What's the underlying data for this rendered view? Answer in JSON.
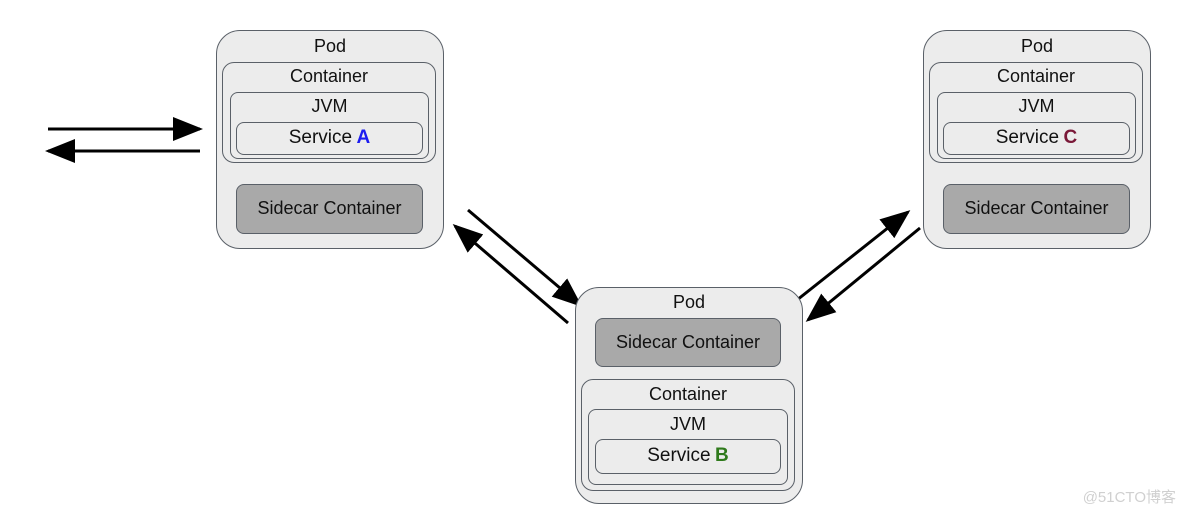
{
  "pods": [
    {
      "id": "a",
      "title": "Pod",
      "container": "Container",
      "jvm": "JVM",
      "service": "Service",
      "letter": "A",
      "letter_color": "#1c1cf0",
      "sidecar": "Sidecar Container"
    },
    {
      "id": "b",
      "title": "Pod",
      "container": "Container",
      "jvm": "JVM",
      "service": "Service",
      "letter": "B",
      "letter_color": "#2f7a1c",
      "sidecar": "Sidecar Container"
    },
    {
      "id": "c",
      "title": "Pod",
      "container": "Container",
      "jvm": "JVM",
      "service": "Service",
      "letter": "C",
      "letter_color": "#7a1838",
      "sidecar": "Sidecar Container"
    }
  ],
  "watermark": "@51CTO博客"
}
